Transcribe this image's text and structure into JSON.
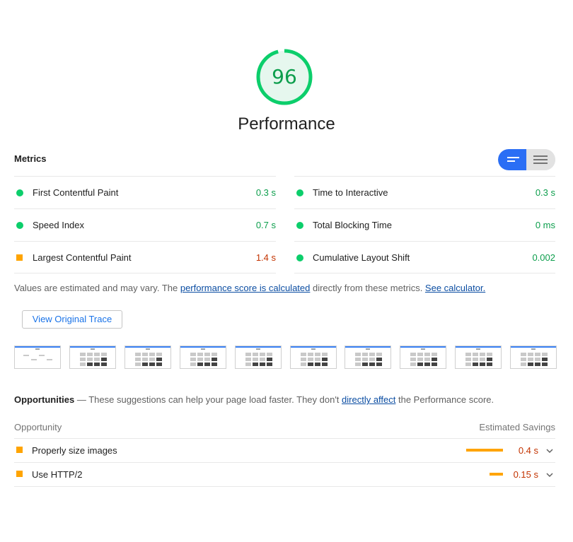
{
  "score": {
    "value": "96",
    "fraction": 0.96,
    "label": "Performance",
    "color": "#0cce6b"
  },
  "metrics": {
    "title": "Metrics",
    "toggle": {
      "selected": "summary",
      "left_icon": "view-summary-icon",
      "right_icon": "view-list-icon"
    },
    "left": [
      {
        "name": "First Contentful Paint",
        "value": "0.3 s",
        "status": "pass"
      },
      {
        "name": "Speed Index",
        "value": "0.7 s",
        "status": "pass"
      },
      {
        "name": "Largest Contentful Paint",
        "value": "1.4 s",
        "status": "average"
      }
    ],
    "right": [
      {
        "name": "Time to Interactive",
        "value": "0.3 s",
        "status": "pass"
      },
      {
        "name": "Total Blocking Time",
        "value": "0 ms",
        "status": "pass"
      },
      {
        "name": "Cumulative Layout Shift",
        "value": "0.002",
        "status": "pass"
      }
    ],
    "description": {
      "prefix": "Values are estimated and may vary. The ",
      "link1": "performance score is calculated",
      "middle": " directly from these metrics. ",
      "link2": "See calculator."
    }
  },
  "trace_button": "View Original Trace",
  "filmstrip": {
    "frame_count": 10
  },
  "opportunities": {
    "title": "Opportunities",
    "dash": " — ",
    "desc_prefix": "These suggestions can help your page load faster. They don't ",
    "desc_link": "directly affect",
    "desc_suffix": " the Performance score.",
    "col_left": "Opportunity",
    "col_right": "Estimated Savings",
    "items": [
      {
        "name": "Properly size images",
        "value": "0.4 s",
        "savings_fraction": 0.4
      },
      {
        "name": "Use HTTP/2",
        "value": "0.15 s",
        "savings_fraction": 0.15
      }
    ]
  },
  "colors": {
    "pass": "#0cce6b",
    "average": "#ffa400",
    "link": "#0b4da2",
    "toggle_active": "#2a6ef5"
  }
}
